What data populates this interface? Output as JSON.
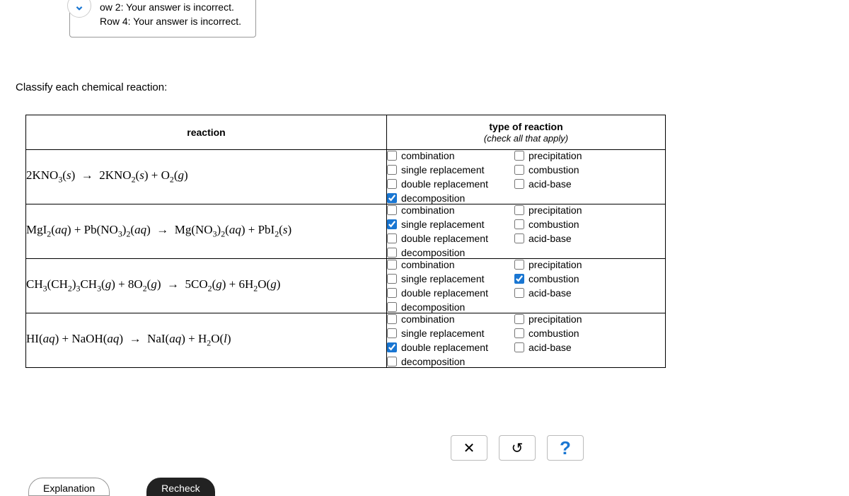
{
  "feedback": {
    "row2": "ow 2: Your answer is incorrect.",
    "row4": "Row 4: Your answer is incorrect."
  },
  "question": "Classify each chemical reaction:",
  "headers": {
    "reaction": "reaction",
    "type": "type of reaction",
    "typeSub": "(check all that apply)"
  },
  "labels": {
    "combination": "combination",
    "single": "single replacement",
    "double": "double replacement",
    "decomposition": "decomposition",
    "precipitation": "precipitation",
    "combustion": "combustion",
    "acid": "acid-base"
  },
  "rows": [
    {
      "checked": [
        "decomposition"
      ]
    },
    {
      "checked": [
        "single"
      ]
    },
    {
      "checked": [
        "combustion"
      ]
    },
    {
      "checked": [
        "double"
      ]
    }
  ],
  "buttons": {
    "close": "✕",
    "reset": "↺",
    "help": "?"
  },
  "footer": {
    "explanation": "Explanation",
    "recheck": "Recheck"
  }
}
